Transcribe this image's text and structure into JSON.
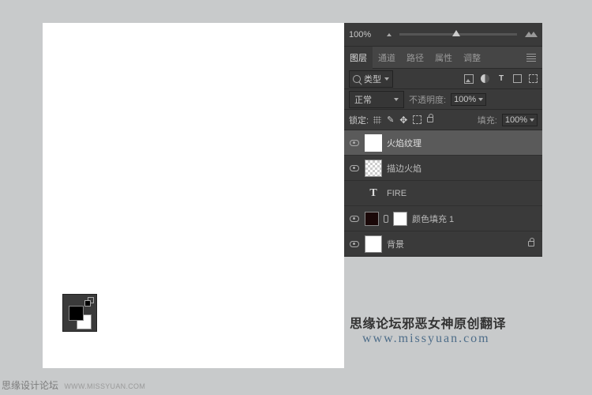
{
  "zoom": {
    "value": "100%"
  },
  "tabs": {
    "layers": "图层",
    "channels": "通道",
    "paths": "路径",
    "properties": "属性",
    "adjustments": "调整"
  },
  "filter": {
    "type_label": "类型"
  },
  "blend": {
    "mode": "正常",
    "opacity_label": "不透明度:",
    "opacity_value": "100%"
  },
  "lock": {
    "label": "锁定:",
    "fill_label": "填充:",
    "fill_value": "100%"
  },
  "layers": [
    {
      "name": "火焰纹理",
      "visible": true,
      "type": "raster",
      "selected": true
    },
    {
      "name": "描边火焰",
      "visible": true,
      "type": "raster_checker"
    },
    {
      "name": "FIRE",
      "visible": false,
      "type": "text"
    },
    {
      "name": "颜色填充 1",
      "visible": true,
      "type": "fill"
    },
    {
      "name": "背景",
      "visible": true,
      "type": "bg",
      "locked": true
    }
  ],
  "watermark": {
    "line1": "思缘论坛邪恶女神原创翻译",
    "line2": "www.missyuan.com"
  },
  "footer": {
    "brand": "思缘设计论坛",
    "url": "WWW.MISSYUAN.COM"
  }
}
